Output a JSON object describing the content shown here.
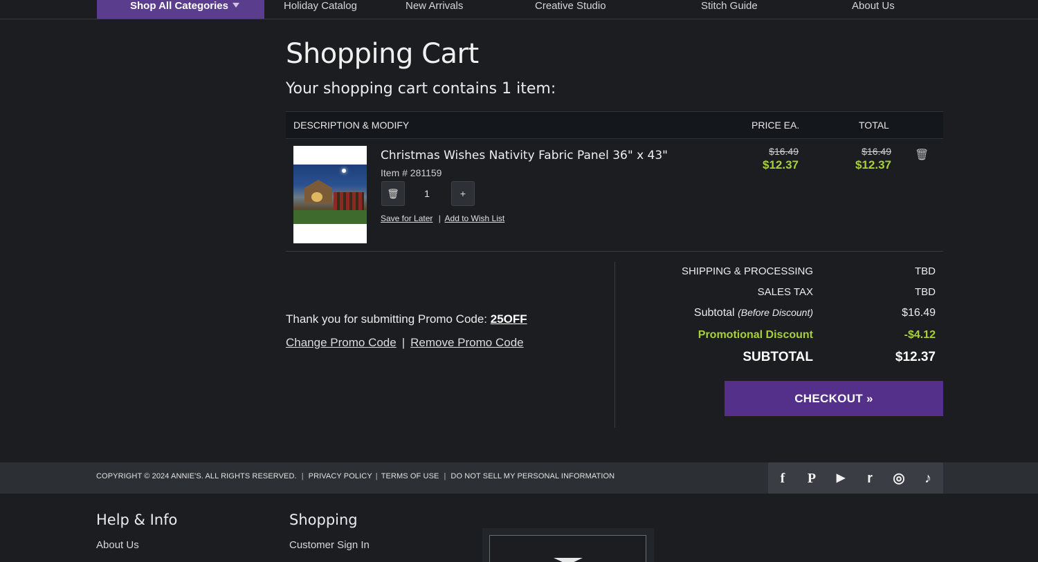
{
  "nav": {
    "shop_all": "Shop All Categories",
    "items": [
      "Holiday Catalog",
      "New Arrivals",
      "Creative Studio",
      "Stitch Guide",
      "About Us"
    ]
  },
  "page": {
    "title": "Shopping Cart",
    "subtitle": "Your shopping cart contains 1 item:"
  },
  "table": {
    "headers": {
      "description": "DESCRIPTION & MODIFY",
      "price": "PRICE EA.",
      "total": "TOTAL"
    }
  },
  "cart_item": {
    "name": "Christmas Wishes Nativity Fabric Panel 36\" x 43\"",
    "item_number": "Item # 281159",
    "quantity": "1",
    "plus": "+",
    "price_original": "$16.49",
    "price_sale": "$12.37",
    "total_original": "$16.49",
    "total_sale": "$12.37",
    "save_for_later": "Save for Later",
    "link_sep": "|",
    "add_to_wish_list": "Add to Wish List"
  },
  "promo": {
    "thanks_text": "Thank you for submitting Promo Code:",
    "code": "25OFF",
    "change": "Change Promo Code",
    "sep": "|",
    "remove": "Remove Promo Code"
  },
  "summary": {
    "shipping_label": "SHIPPING & PROCESSING",
    "shipping_value": "TBD",
    "tax_label": "SALES TAX",
    "tax_value": "TBD",
    "subtotal_before_label": "Subtotal",
    "subtotal_before_note": "(Before Discount)",
    "subtotal_before_value": "$16.49",
    "discount_label": "Promotional Discount",
    "discount_value": "-$4.12",
    "subtotal_label": "SUBTOTAL",
    "subtotal_value": "$12.37",
    "checkout": "CHECKOUT »",
    "accent_color": "#54308a",
    "sale_color": "#a8d03c"
  },
  "footer": {
    "copyright": "COPYRIGHT © 2024 ANNIE'S. ALL RIGHTS RESERVED.",
    "privacy": "PRIVACY POLICY",
    "terms": "TERMS OF USE",
    "dnsmpi": "DO NOT SELL MY PERSONAL INFORMATION",
    "pipe": "|",
    "social": {
      "facebook": "f",
      "pinterest": "P",
      "youtube": "▶",
      "ravelry": "r",
      "instagram": "◎",
      "tiktok": "♪"
    },
    "col1_title": "Help & Info",
    "col1_links": [
      "About Us"
    ],
    "col2_title": "Shopping",
    "col2_links": [
      "Customer Sign In"
    ]
  }
}
